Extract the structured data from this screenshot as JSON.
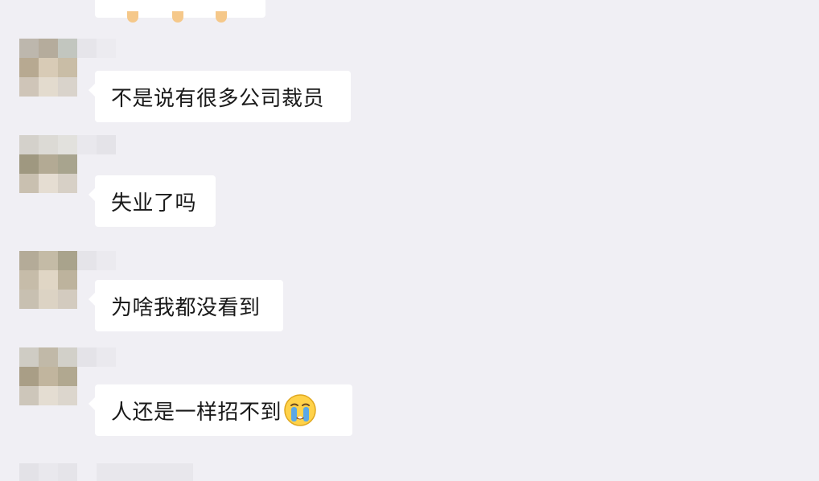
{
  "messages": [
    {
      "text": "不是说有很多公司裁员"
    },
    {
      "text": "失业了吗"
    },
    {
      "text": "为啥我都没看到"
    },
    {
      "text": "人还是一样招不到",
      "emoji": "crying-face-icon"
    }
  ],
  "colors": {
    "background": "#f0eff4",
    "bubble": "#ffffff",
    "text": "#1a1a1a",
    "emoji_face": "#ffd24a",
    "emoji_tears": "#5aa8e6"
  }
}
